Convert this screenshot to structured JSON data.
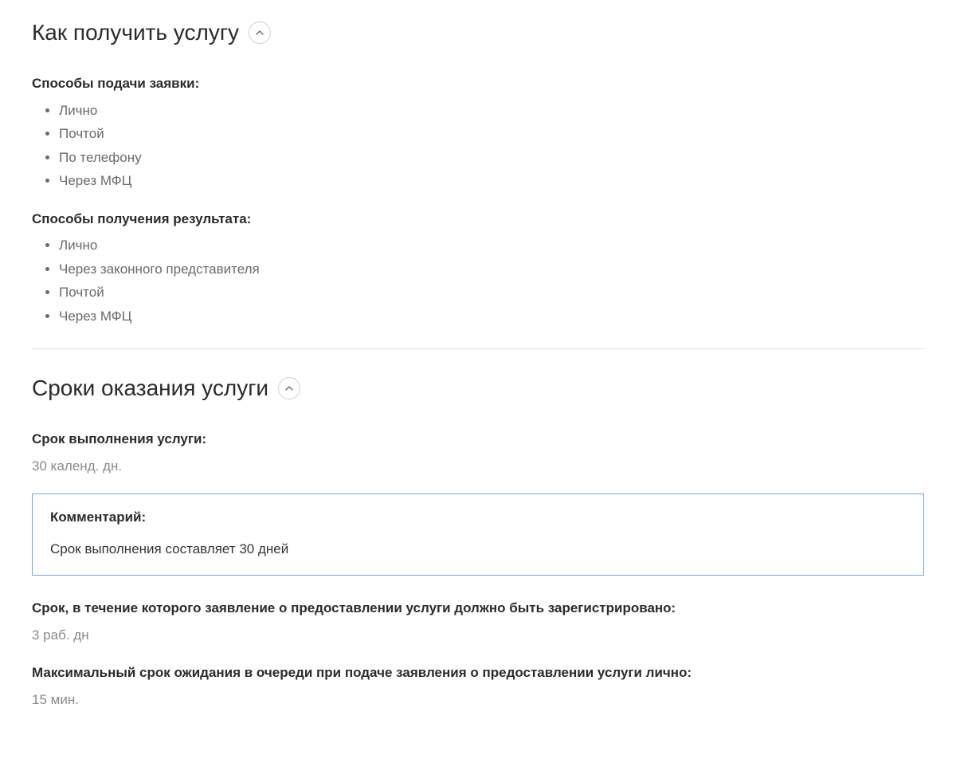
{
  "section1": {
    "title": "Как получить услугу",
    "submit_heading": "Способы подачи заявки:",
    "submit_items": [
      "Лично",
      "Почтой",
      "По телефону",
      "Через МФЦ"
    ],
    "result_heading": "Способы получения результата:",
    "result_items": [
      "Лично",
      "Через законного представителя",
      "Почтой",
      "Через МФЦ"
    ]
  },
  "section2": {
    "title": "Сроки оказания услуги",
    "duration_label": "Срок выполнения услуги:",
    "duration_value": "30 календ. дн.",
    "comment_label": "Комментарий:",
    "comment_text": "Срок выполнения составляет 30 дней",
    "register_label": "Срок, в течение которого заявление о предоставлении услуги должно быть зарегистрировано:",
    "register_value": "3 раб. дн",
    "queue_label": "Максимальный срок ожидания в очереди при подаче заявления о предоставлении услуги лично:",
    "queue_value": "15 мин."
  }
}
